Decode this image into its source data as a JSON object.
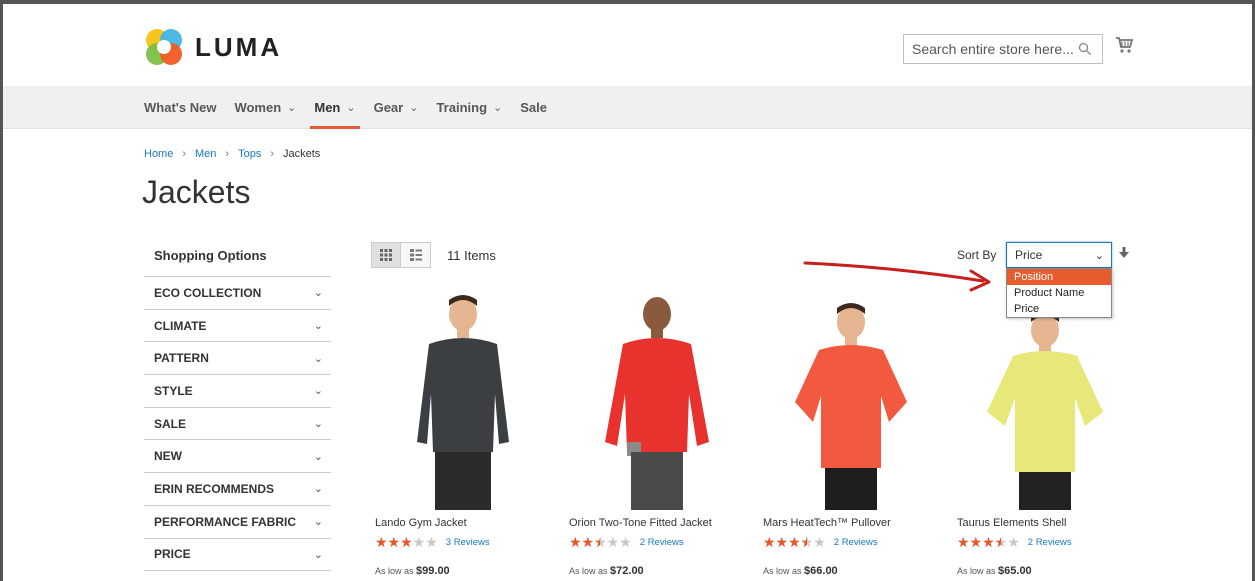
{
  "header": {
    "logo_text": "LUMA",
    "search_placeholder": "Search entire store here..."
  },
  "nav": {
    "items": [
      {
        "label": "What's New",
        "has_menu": false
      },
      {
        "label": "Women",
        "has_menu": true
      },
      {
        "label": "Men",
        "has_menu": true,
        "active": true
      },
      {
        "label": "Gear",
        "has_menu": true
      },
      {
        "label": "Training",
        "has_menu": true
      },
      {
        "label": "Sale",
        "has_menu": false
      }
    ]
  },
  "breadcrumb": [
    "Home",
    "Men",
    "Tops",
    "Jackets"
  ],
  "page_title": "Jackets",
  "sidebar": {
    "title": "Shopping Options",
    "filters": [
      "ECO COLLECTION",
      "CLIMATE",
      "PATTERN",
      "STYLE",
      "SALE",
      "NEW",
      "ERIN RECOMMENDS",
      "PERFORMANCE FABRIC",
      "PRICE"
    ]
  },
  "toolbar": {
    "item_count": "11 Items",
    "sort_label": "Sort By",
    "sort_selected": "Price",
    "sort_options": [
      "Position",
      "Product Name",
      "Price"
    ],
    "highlighted_option": "Position"
  },
  "products": [
    {
      "name": "Lando Gym Jacket",
      "rating": 3,
      "reviews": "3 Reviews",
      "price_prefix": "As low as",
      "price": "$99.00",
      "jacket_color": "#3c3f42"
    },
    {
      "name": "Orion Two-Tone Fitted Jacket",
      "rating": 2.5,
      "reviews": "2 Reviews",
      "price_prefix": "As low as",
      "price": "$72.00",
      "jacket_color": "#e8322e"
    },
    {
      "name": "Mars HeatTech™ Pullover",
      "rating": 3.5,
      "reviews": "2 Reviews",
      "price_prefix": "As low as",
      "price": "$66.00",
      "jacket_color": "#f25a3f"
    },
    {
      "name": "Taurus Elements Shell",
      "rating": 3.5,
      "reviews": "2 Reviews",
      "price_prefix": "As low as",
      "price": "$65.00",
      "jacket_color": "#e8e77a"
    }
  ],
  "colors": {
    "accent": "#e35b36",
    "link": "#1979c3",
    "star": "#e8572a",
    "arrow": "#c81e1e"
  }
}
